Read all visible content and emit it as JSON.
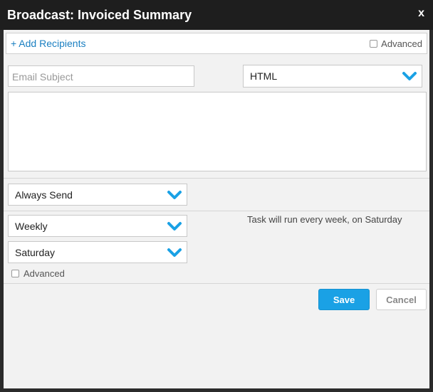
{
  "dialog": {
    "title": "Broadcast: Invoiced Summary",
    "close_label": "x"
  },
  "recipients": {
    "add_label": "+ Add Recipients",
    "advanced_label": "Advanced",
    "advanced_checked": false
  },
  "email": {
    "subject_placeholder": "Email Subject",
    "subject_value": "",
    "format_selected": "HTML",
    "body_value": ""
  },
  "schedule": {
    "condition_selected": "Always Send",
    "frequency_selected": "Weekly",
    "day_selected": "Saturday",
    "summary_text": "Task will run every week, on Saturday",
    "advanced_label": "Advanced",
    "advanced_checked": false
  },
  "actions": {
    "save_label": "Save",
    "cancel_label": "Cancel"
  },
  "colors": {
    "accent": "#1aa1e5",
    "link": "#1a7fc1",
    "titlebar": "#1e1e1e"
  },
  "icons": {
    "dropdown": "chevron-down-icon",
    "close": "close-icon"
  }
}
